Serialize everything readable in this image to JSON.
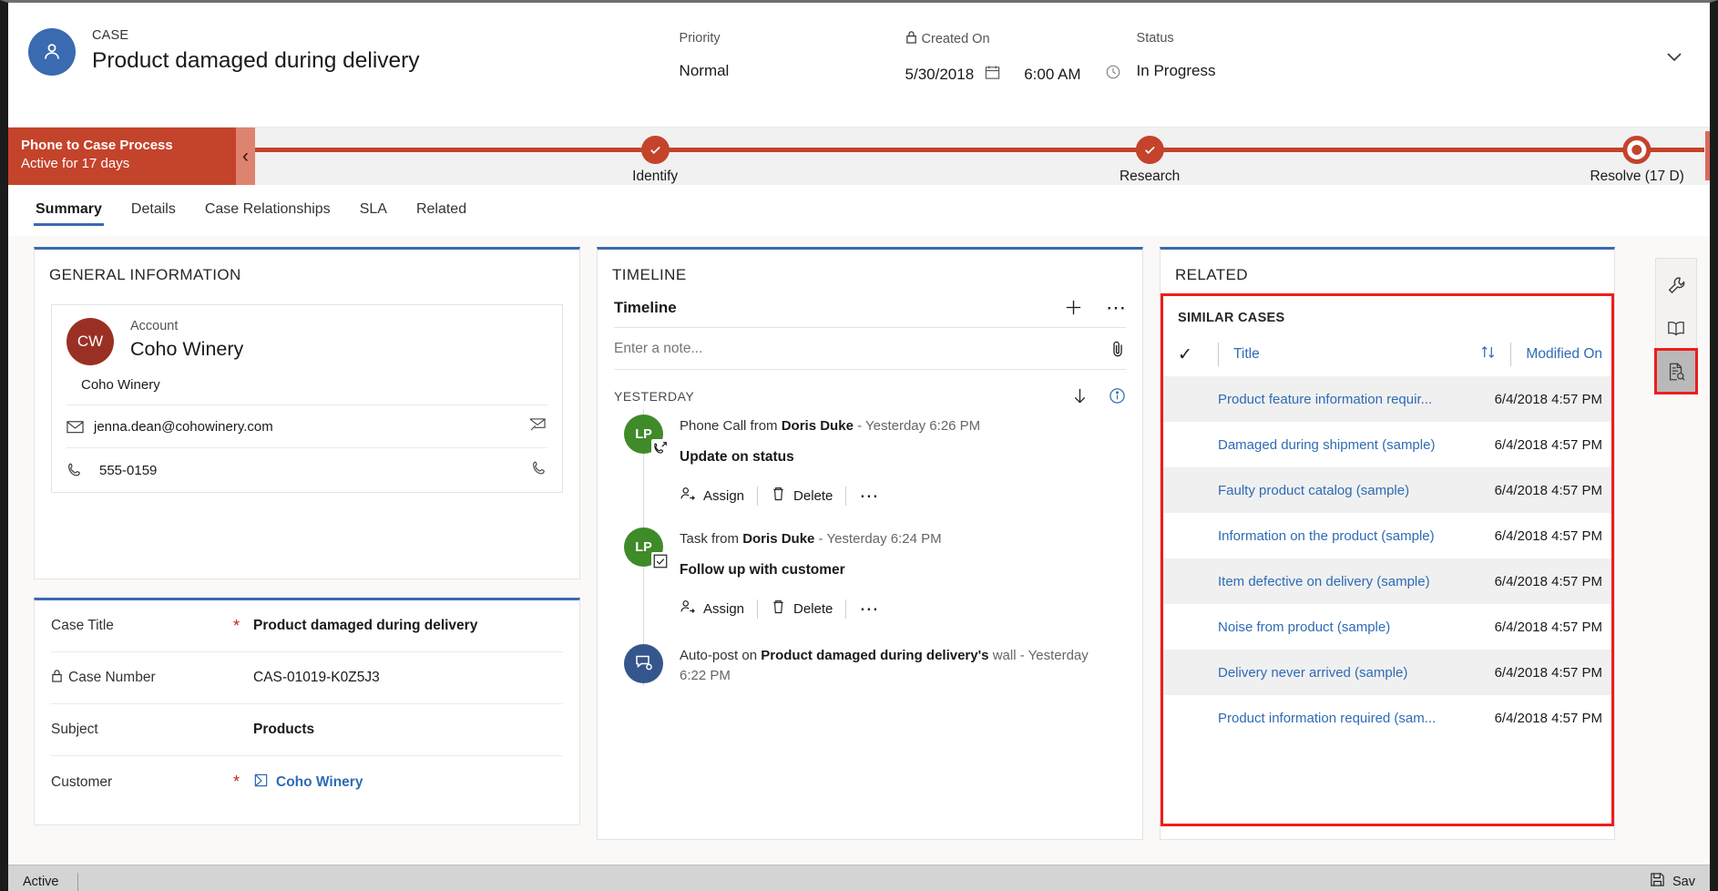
{
  "header": {
    "entity_type": "CASE",
    "title": "Product damaged during delivery",
    "avatar_icon": "contact-person-icon",
    "fields": [
      {
        "label": "Priority",
        "value": "Normal",
        "lock": false
      },
      {
        "label": "Created On",
        "value": "5/30/2018",
        "value2": "6:00 AM",
        "lock": true
      },
      {
        "label": "Status",
        "value": "In Progress",
        "lock": false
      }
    ]
  },
  "process": {
    "name": "Phone to Case Process",
    "active_for": "Active for 17 days",
    "collapse_icon": "chevron-left-icon",
    "stages": [
      {
        "label": "Identify",
        "state": "complete"
      },
      {
        "label": "Research",
        "state": "complete"
      },
      {
        "label": "Resolve  (17 D)",
        "state": "current"
      }
    ]
  },
  "tabs": [
    {
      "label": "Summary",
      "active": true
    },
    {
      "label": "Details",
      "active": false
    },
    {
      "label": "Case Relationships",
      "active": false
    },
    {
      "label": "SLA",
      "active": false
    },
    {
      "label": "Related",
      "active": false
    }
  ],
  "general_information": {
    "card_title": "GENERAL INFORMATION",
    "account": {
      "label": "Account",
      "initials": "CW",
      "name": "Coho Winery",
      "sub_name": "Coho Winery",
      "email": "jenna.dean@cohowinery.com",
      "phone": "555-0159"
    },
    "fields": [
      {
        "label": "Case Title",
        "value": "Product damaged during delivery",
        "required": true,
        "lock": false,
        "type": "text"
      },
      {
        "label": "Case Number",
        "value": "CAS-01019-K0Z5J3",
        "required": false,
        "lock": true,
        "type": "plain"
      },
      {
        "label": "Subject",
        "value": "Products",
        "required": false,
        "lock": false,
        "type": "text"
      },
      {
        "label": "Customer",
        "value": "Coho Winery",
        "required": true,
        "lock": false,
        "type": "link"
      }
    ]
  },
  "timeline": {
    "card_title": "TIMELINE",
    "header_title": "Timeline",
    "add_icon": "plus-icon",
    "more_icon": "ellipsis-icon",
    "note_placeholder": "Enter a note...",
    "attach_icon": "paperclip-icon",
    "section_label": "YESTERDAY",
    "sort_icon": "arrow-down-icon",
    "info_icon": "info-circle-icon",
    "action_assign": "Assign",
    "action_delete": "Delete",
    "items": [
      {
        "initials": "LP",
        "color": "green",
        "badge_icon": "phone-outgoing-icon",
        "prefix": "Phone Call from ",
        "actor": "Doris Duke",
        "time": " -  Yesterday 6:26 PM",
        "subject": "Update on status",
        "has_actions": true
      },
      {
        "initials": "LP",
        "color": "green",
        "badge_icon": "task-checkbox-icon",
        "prefix": "Task from ",
        "actor": "Doris Duke",
        "time": "  -  Yesterday 6:24 PM",
        "subject": "Follow up with customer",
        "has_actions": true
      },
      {
        "initials": "",
        "color": "blue",
        "badge_icon": "auto-post-gear-icon",
        "prefix": "Auto-post on ",
        "actor": "Product damaged during delivery's",
        "time": " wall -  Yesterday 6:22 PM",
        "subject": "",
        "has_actions": false
      }
    ]
  },
  "related": {
    "card_title": "RELATED",
    "subsection_title": "SIMILAR CASES",
    "check_icon": "checkmark-icon",
    "sort_icon": "sort-updown-icon",
    "columns": {
      "title": "Title",
      "modified_on": "Modified On"
    },
    "rows": [
      {
        "title": "Product feature information requir...",
        "modified_on": "6/4/2018 4:57 PM"
      },
      {
        "title": "Damaged during shipment (sample)",
        "modified_on": "6/4/2018 4:57 PM"
      },
      {
        "title": "Faulty product catalog (sample)",
        "modified_on": "6/4/2018 4:57 PM"
      },
      {
        "title": "Information on the product (sample)",
        "modified_on": "6/4/2018 4:57 PM"
      },
      {
        "title": "Item defective on delivery (sample)",
        "modified_on": "6/4/2018 4:57 PM"
      },
      {
        "title": "Noise from product (sample)",
        "modified_on": "6/4/2018 4:57 PM"
      },
      {
        "title": "Delivery never arrived (sample)",
        "modified_on": "6/4/2018 4:57 PM"
      },
      {
        "title": "Product information required (sam...",
        "modified_on": "6/4/2018 4:57 PM"
      }
    ]
  },
  "rail": [
    {
      "icon": "wrench-icon",
      "selected": false
    },
    {
      "icon": "book-knowledge-icon",
      "selected": false
    },
    {
      "icon": "similar-records-icon",
      "selected": true
    }
  ],
  "footer": {
    "status": "Active",
    "save_icon": "save-disk-icon",
    "save_label": "Sav"
  },
  "colors": {
    "accent_blue": "#3a6ab0",
    "process_red": "#c4432b",
    "highlight_red": "#ee1d1d",
    "link_blue": "#2e6bb5",
    "account_red": "#9a3023",
    "timeline_green": "#3f8a29"
  }
}
